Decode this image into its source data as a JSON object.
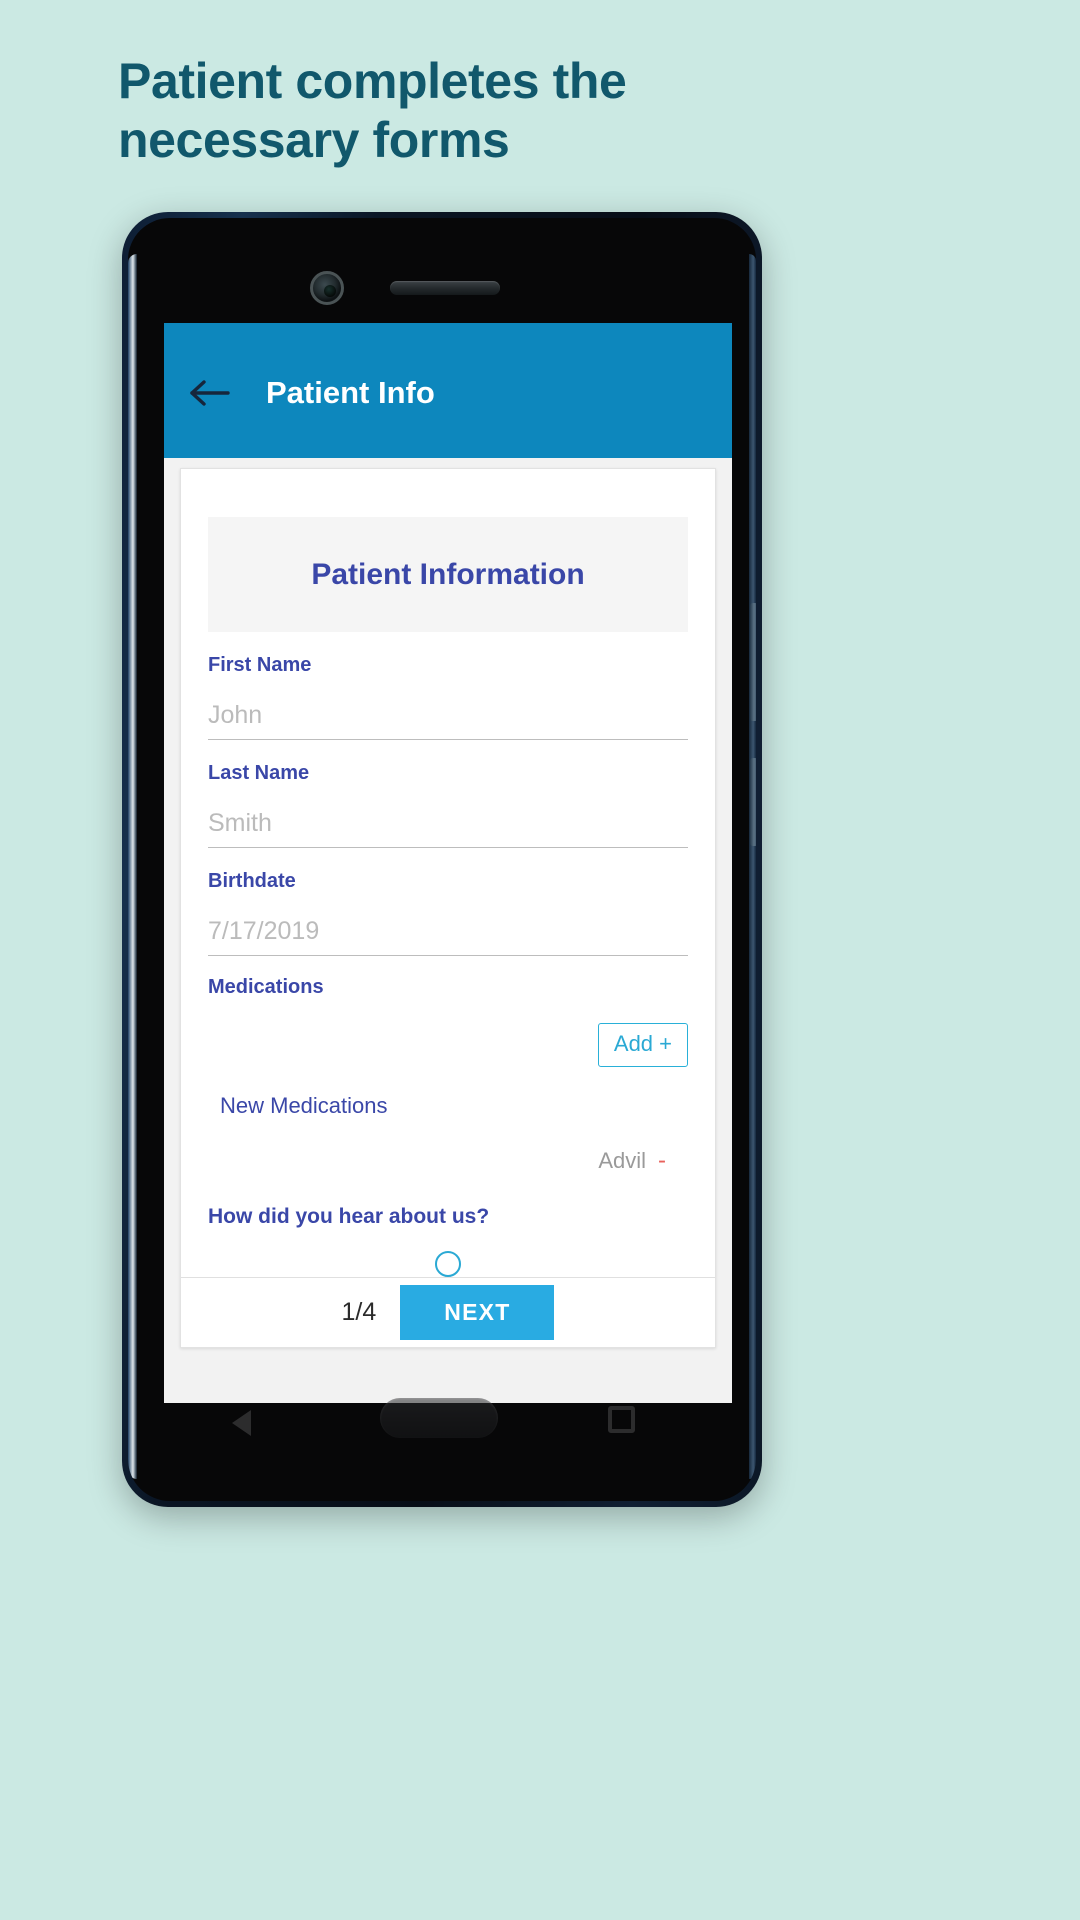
{
  "heading": {
    "line1": "Patient completes the",
    "line2": "necessary forms",
    "color": "#11586c"
  },
  "theme": {
    "background": "#cbe9e3",
    "appbar_blue": "#0d87bd",
    "accent_blue": "#29abe2",
    "label_indigo": "#3a47a8",
    "placeholder_gray": "#bbbbbb",
    "outline_cyan": "#29b0d8"
  },
  "phone": {
    "hardware": {
      "camera_icon": "front-camera-icon",
      "speaker_icon": "earpiece-speaker-icon",
      "nav_back_icon": "triangle-back-icon",
      "nav_home_icon": "home-pill-icon",
      "nav_recents_icon": "square-recents-icon"
    }
  },
  "app": {
    "statusbar": {
      "left": "",
      "right": ""
    },
    "appbar": {
      "back_icon": "arrow-left-icon",
      "title": "Patient Info"
    },
    "form": {
      "banner_title": "Patient Information",
      "fields": [
        {
          "label": "First Name",
          "placeholder": "John",
          "value": ""
        },
        {
          "label": "Last Name",
          "placeholder": "Smith",
          "value": ""
        },
        {
          "label": "Birthdate",
          "placeholder": "7/17/2019",
          "value": ""
        }
      ],
      "medications": {
        "label": "Medications",
        "add_button": "Add +",
        "list_title": "New Medications",
        "items": [
          {
            "name": "Advil",
            "remove": "-"
          }
        ]
      },
      "hear_about": {
        "label": "How did you hear about us?",
        "option_icon": "radio-circle-icon"
      }
    },
    "footer": {
      "page_indicator": "1/4",
      "next_label": "NEXT"
    }
  }
}
